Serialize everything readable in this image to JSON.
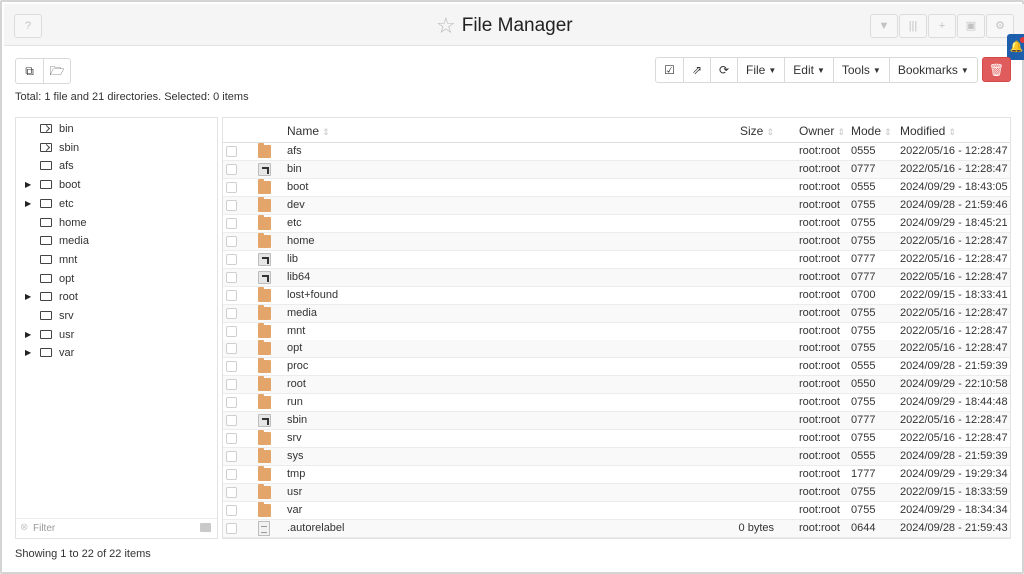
{
  "window": {
    "title": "File Manager"
  },
  "titlebar_buttons": {
    "left": {
      "icon": "help-icon",
      "glyph": "?"
    },
    "right": [
      {
        "icon": "filter-icon",
        "glyph": "▼"
      },
      {
        "icon": "columns-icon",
        "glyph": "|||"
      },
      {
        "icon": "add-icon",
        "glyph": "+"
      },
      {
        "icon": "window-icon",
        "glyph": "▣"
      },
      {
        "icon": "gear-icon",
        "glyph": "⚙"
      }
    ]
  },
  "toolbar": {
    "left_buttons": [
      {
        "icon": "new-window-icon",
        "glyph": "⧉"
      },
      {
        "icon": "open-folder-icon",
        "glyph": "🗁"
      }
    ],
    "icon_buttons": [
      {
        "icon": "check-square-icon",
        "glyph": "☑"
      },
      {
        "icon": "share-icon",
        "glyph": "⇗"
      },
      {
        "icon": "refresh-icon",
        "glyph": "⟳"
      }
    ],
    "menus": [
      "File",
      "Edit",
      "Tools",
      "Bookmarks"
    ],
    "delete": {
      "icon": "trash-icon",
      "glyph": "🗑"
    }
  },
  "summary": "Total: 1 file and 21 directories. Selected: 0 items",
  "tree": {
    "items": [
      {
        "label": "bin",
        "expandable": false,
        "link": true
      },
      {
        "label": "sbin",
        "expandable": false,
        "link": true
      },
      {
        "label": "afs",
        "expandable": false,
        "link": false
      },
      {
        "label": "boot",
        "expandable": true,
        "link": false
      },
      {
        "label": "etc",
        "expandable": true,
        "link": false
      },
      {
        "label": "home",
        "expandable": false,
        "link": false
      },
      {
        "label": "media",
        "expandable": false,
        "link": false
      },
      {
        "label": "mnt",
        "expandable": false,
        "link": false
      },
      {
        "label": "opt",
        "expandable": false,
        "link": false
      },
      {
        "label": "root",
        "expandable": true,
        "link": false
      },
      {
        "label": "srv",
        "expandable": false,
        "link": false
      },
      {
        "label": "usr",
        "expandable": true,
        "link": false
      },
      {
        "label": "var",
        "expandable": true,
        "link": false
      }
    ],
    "filter_placeholder": "Filter"
  },
  "table": {
    "headers": {
      "name": "Name",
      "size": "Size",
      "owner": "Owner",
      "mode": "Mode",
      "modified": "Modified"
    },
    "rows": [
      {
        "name": "afs",
        "type": "folder",
        "size": "",
        "owner": "root:root",
        "mode": "0555",
        "modified": "2022/05/16 - 12:28:47"
      },
      {
        "name": "bin",
        "type": "link",
        "size": "",
        "owner": "root:root",
        "mode": "0777",
        "modified": "2022/05/16 - 12:28:47"
      },
      {
        "name": "boot",
        "type": "folder",
        "size": "",
        "owner": "root:root",
        "mode": "0555",
        "modified": "2024/09/29 - 18:43:05"
      },
      {
        "name": "dev",
        "type": "folder",
        "size": "",
        "owner": "root:root",
        "mode": "0755",
        "modified": "2024/09/28 - 21:59:46"
      },
      {
        "name": "etc",
        "type": "folder",
        "size": "",
        "owner": "root:root",
        "mode": "0755",
        "modified": "2024/09/29 - 18:45:21"
      },
      {
        "name": "home",
        "type": "folder",
        "size": "",
        "owner": "root:root",
        "mode": "0755",
        "modified": "2022/05/16 - 12:28:47"
      },
      {
        "name": "lib",
        "type": "link",
        "size": "",
        "owner": "root:root",
        "mode": "0777",
        "modified": "2022/05/16 - 12:28:47"
      },
      {
        "name": "lib64",
        "type": "link",
        "size": "",
        "owner": "root:root",
        "mode": "0777",
        "modified": "2022/05/16 - 12:28:47"
      },
      {
        "name": "lost+found",
        "type": "folder",
        "size": "",
        "owner": "root:root",
        "mode": "0700",
        "modified": "2022/09/15 - 18:33:41"
      },
      {
        "name": "media",
        "type": "folder",
        "size": "",
        "owner": "root:root",
        "mode": "0755",
        "modified": "2022/05/16 - 12:28:47"
      },
      {
        "name": "mnt",
        "type": "folder",
        "size": "",
        "owner": "root:root",
        "mode": "0755",
        "modified": "2022/05/16 - 12:28:47"
      },
      {
        "name": "opt",
        "type": "folder",
        "size": "",
        "owner": "root:root",
        "mode": "0755",
        "modified": "2022/05/16 - 12:28:47"
      },
      {
        "name": "proc",
        "type": "folder",
        "size": "",
        "owner": "root:root",
        "mode": "0555",
        "modified": "2024/09/28 - 21:59:39"
      },
      {
        "name": "root",
        "type": "folder",
        "size": "",
        "owner": "root:root",
        "mode": "0550",
        "modified": "2024/09/29 - 22:10:58"
      },
      {
        "name": "run",
        "type": "folder",
        "size": "",
        "owner": "root:root",
        "mode": "0755",
        "modified": "2024/09/29 - 18:44:48"
      },
      {
        "name": "sbin",
        "type": "link",
        "size": "",
        "owner": "root:root",
        "mode": "0777",
        "modified": "2022/05/16 - 12:28:47"
      },
      {
        "name": "srv",
        "type": "folder",
        "size": "",
        "owner": "root:root",
        "mode": "0755",
        "modified": "2022/05/16 - 12:28:47"
      },
      {
        "name": "sys",
        "type": "folder",
        "size": "",
        "owner": "root:root",
        "mode": "0555",
        "modified": "2024/09/28 - 21:59:39"
      },
      {
        "name": "tmp",
        "type": "folder",
        "size": "",
        "owner": "root:root",
        "mode": "1777",
        "modified": "2024/09/29 - 19:29:34"
      },
      {
        "name": "usr",
        "type": "folder",
        "size": "",
        "owner": "root:root",
        "mode": "0755",
        "modified": "2022/09/15 - 18:33:59"
      },
      {
        "name": "var",
        "type": "folder",
        "size": "",
        "owner": "root:root",
        "mode": "0755",
        "modified": "2024/09/29 - 18:34:34"
      },
      {
        "name": ".autorelabel",
        "type": "file",
        "size": "0 bytes",
        "owner": "root:root",
        "mode": "0644",
        "modified": "2024/09/28 - 21:59:43"
      }
    ]
  },
  "footer": "Showing 1 to 22 of 22 items",
  "colors": {
    "folder": "#e3a569",
    "delete": "#e05c5c",
    "notification": "#1e5fad"
  }
}
